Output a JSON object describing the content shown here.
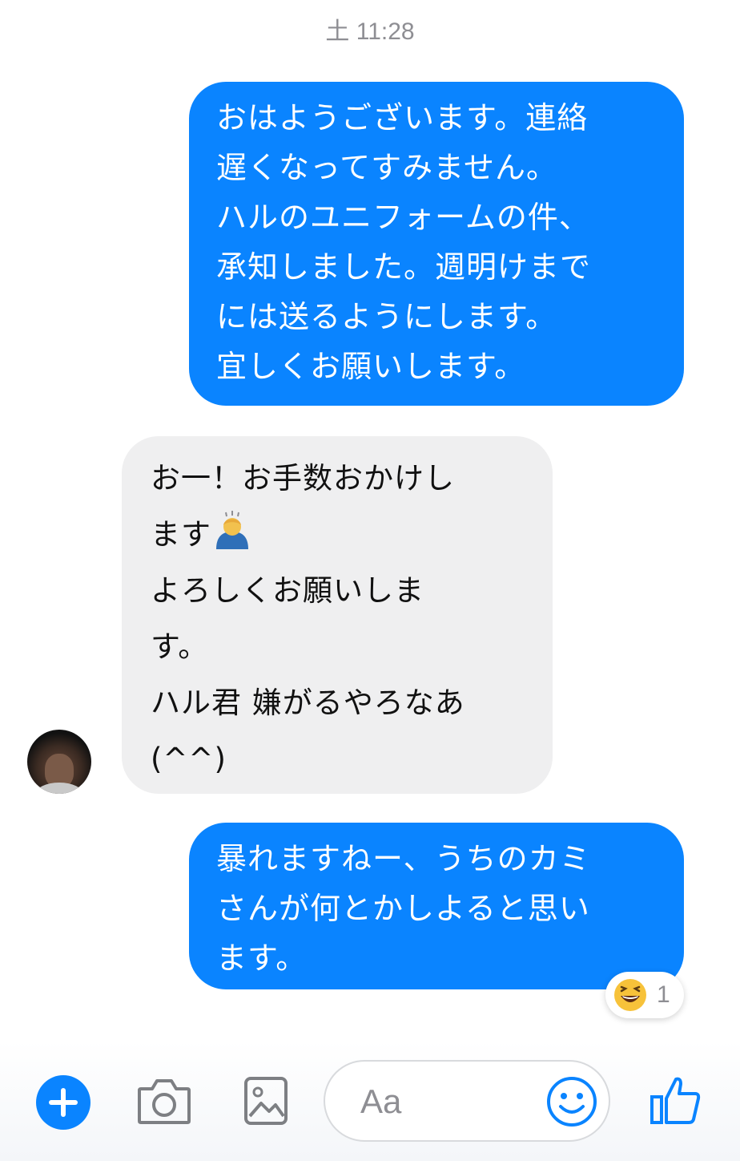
{
  "timestamp": "土 11:28",
  "messages": [
    {
      "direction": "outgoing",
      "text": "おはようございます。連絡\n遅くなってすみません。\nハルのユニフォームの件、\n承知しました。週明けまで\nには送るようにします。\n宜しくお願いします。"
    },
    {
      "direction": "incoming",
      "line1": "お一！お手数おかけし",
      "line2": "ます",
      "emoji": "person-bowing-emoji",
      "line3": "よろしくお願いしま\nす。\nハル君 嫌がるやろなあ\n(^^)"
    },
    {
      "direction": "outgoing",
      "text": "暴れますねー、うちのカミ\nさんが何とかしよると思い\nます。",
      "reaction": {
        "emoji": "laughing-emoji",
        "count": "1"
      }
    }
  ],
  "composer": {
    "placeholder": "Aa",
    "icons": [
      "plus-icon",
      "camera-icon",
      "gallery-icon",
      "smiley-icon",
      "thumbs-up-icon"
    ]
  },
  "colors": {
    "outgoing_bubble": "#0a84ff",
    "incoming_bubble": "#efeff0",
    "accent": "#0a84ff"
  }
}
